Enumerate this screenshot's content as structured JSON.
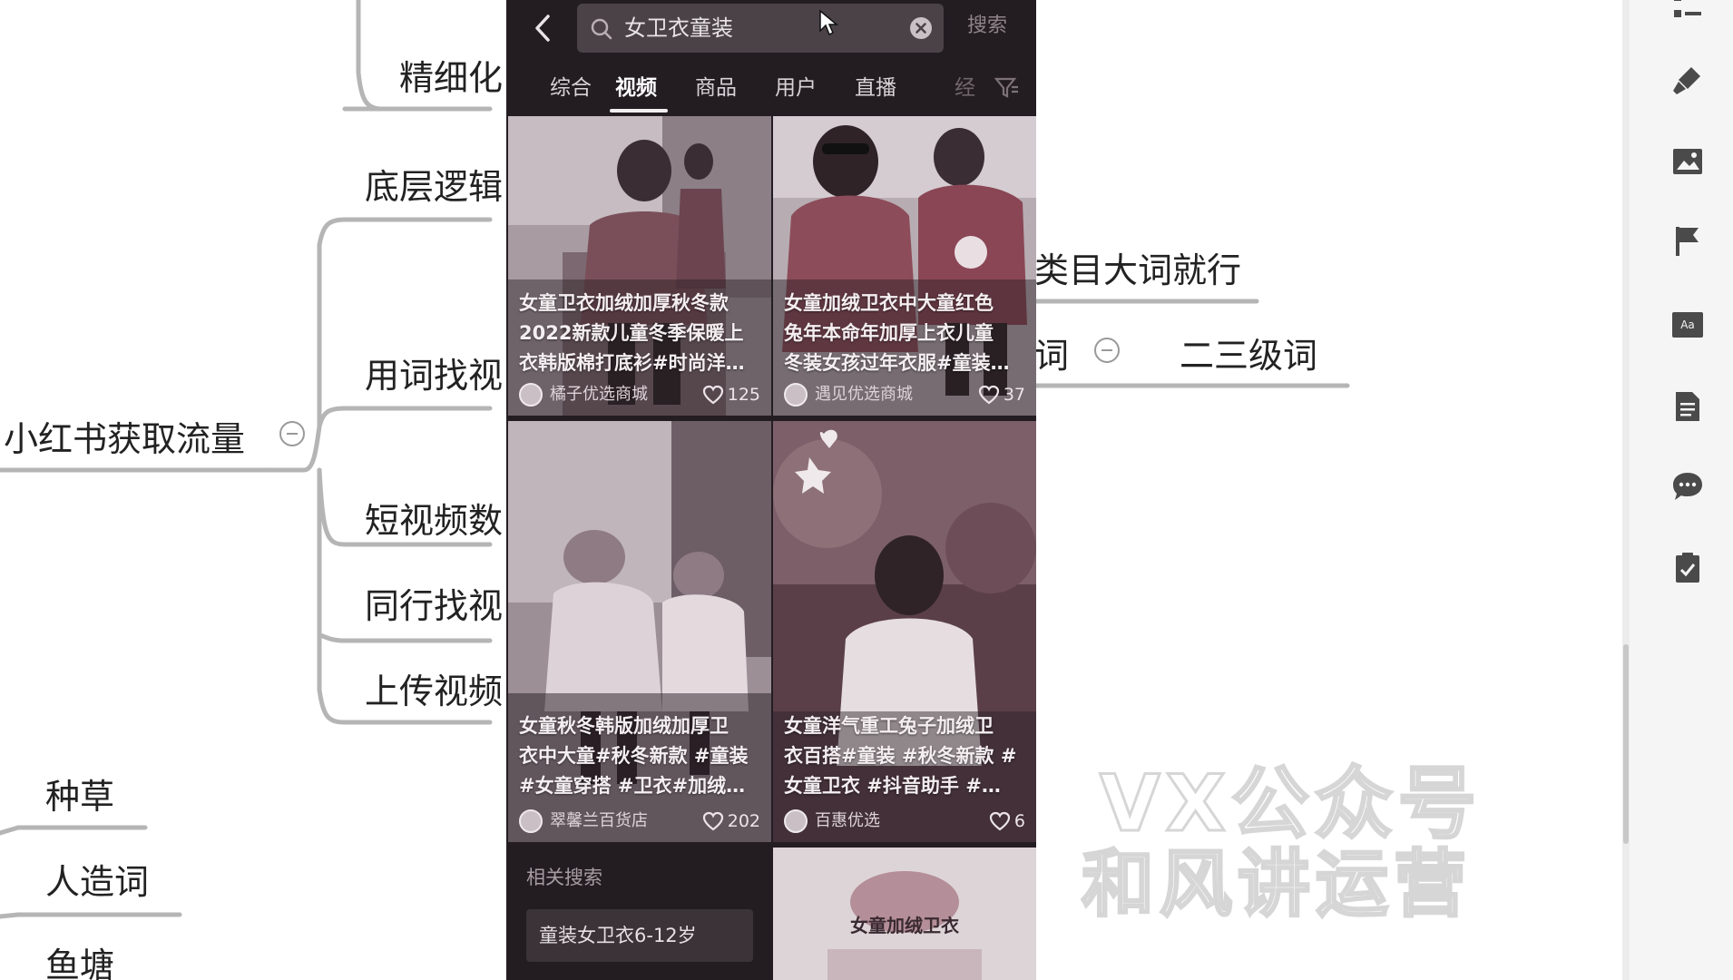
{
  "mindmap": {
    "root": "小红书获取流量",
    "branches": [
      "精细化",
      "底层逻辑",
      "用词找视",
      "短视频数",
      "同行找视",
      "上传视频"
    ],
    "right_nodes": {
      "category_words": "类目大词就行",
      "word_fragment": "词",
      "secondary_words": "二三级词"
    },
    "lower_nodes": [
      "种草",
      "人造词",
      "鱼塘"
    ]
  },
  "watermark": {
    "line1": "VX公众号",
    "line2": "和风讲运营"
  },
  "phone": {
    "search": {
      "query": "女卫衣童装",
      "button_label": "搜索"
    },
    "tabs": [
      {
        "label": "综合"
      },
      {
        "label": "视频",
        "active": true
      },
      {
        "label": "商品"
      },
      {
        "label": "用户"
      },
      {
        "label": "直播"
      },
      {
        "label": "经"
      }
    ],
    "cards": [
      {
        "caption": "女童卫衣加绒加厚秋冬款\n2022新款儿童冬季保暖上\n衣韩版棉打底衫#时尚洋…",
        "author": "橘子优选商城",
        "likes": "125"
      },
      {
        "caption": "女童加绒卫衣中大童红色\n兔年本命年加厚上衣儿童\n冬装女孩过年衣服#童装…",
        "author": "遇见优选商城",
        "likes": "37"
      },
      {
        "caption": "女童秋冬韩版加绒加厚卫\n衣中大童#秋冬新款 #童装\n#女童穿搭 #卫衣#加绒…",
        "author": "翠馨兰百货店",
        "likes": "202"
      },
      {
        "caption": "女童洋气重工兔子加绒卫\n衣百搭#童装 #秋冬新款 #\n女童卫衣 #抖音助手 #…",
        "author": "百惠优选",
        "likes": "6"
      }
    ],
    "related": {
      "title": "相关搜索",
      "items": [
        "童装女卫衣6-12岁"
      ]
    },
    "bottom_card_text": "女童加绒卫衣"
  },
  "colors": {
    "phone_bg": "#231d22",
    "mindmap_line": "#b5b5b5",
    "toolbar_icon": "#4a4a4a"
  }
}
